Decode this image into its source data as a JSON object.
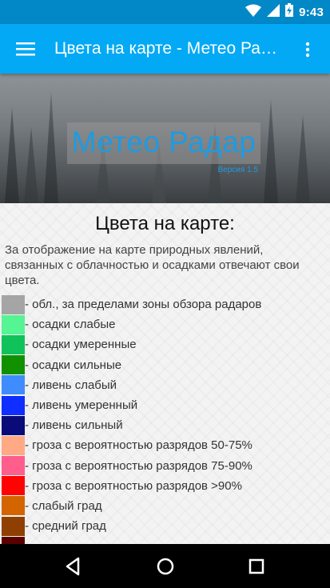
{
  "status_bar": {
    "time": "9:43",
    "icons": [
      "wifi-icon",
      "signal-icon",
      "battery-charging-icon"
    ]
  },
  "app_bar": {
    "title": "Цвета на карте - Метео Радар",
    "menu_icon": "hamburger-menu-icon",
    "overflow_icon": "more-vert-icon"
  },
  "hero": {
    "title": "Метео Радар",
    "version": "Версия 1.5"
  },
  "content": {
    "heading": "Цвета на карте:",
    "intro": "За отображение на карте природных явлений, связанных с облачностью и осадками отвечают свои цвета."
  },
  "legend": [
    {
      "color": "#a5a5a5",
      "label": "- обл., за пределами зоны обзора радаров"
    },
    {
      "color": "#54f592",
      "label": "- осадки слабые"
    },
    {
      "color": "#10c25a",
      "label": "- осадки умеренные"
    },
    {
      "color": "#119100",
      "label": "- осадки сильные"
    },
    {
      "color": "#3f8cff",
      "label": "- ливень слабый"
    },
    {
      "color": "#0f2eff",
      "label": "- ливень умеренный"
    },
    {
      "color": "#0a0a78",
      "label": "- ливень сильный"
    },
    {
      "color": "#ffaa84",
      "label": "- гроза с вероятностью разрядов 50-75%"
    },
    {
      "color": "#ff5e8c",
      "label": "- гроза с вероятностью разрядов 75-90%"
    },
    {
      "color": "#ff0202",
      "label": "- гроза с вероятностью разрядов >90%"
    },
    {
      "color": "#d36400",
      "label": "- слабый град"
    },
    {
      "color": "#8f4000",
      "label": "- средний град"
    },
    {
      "color": "#5a0000",
      "label": ""
    }
  ],
  "nav_bar": {
    "back_icon": "back-triangle-icon",
    "home_icon": "home-circle-icon",
    "recents_icon": "recents-square-icon"
  }
}
